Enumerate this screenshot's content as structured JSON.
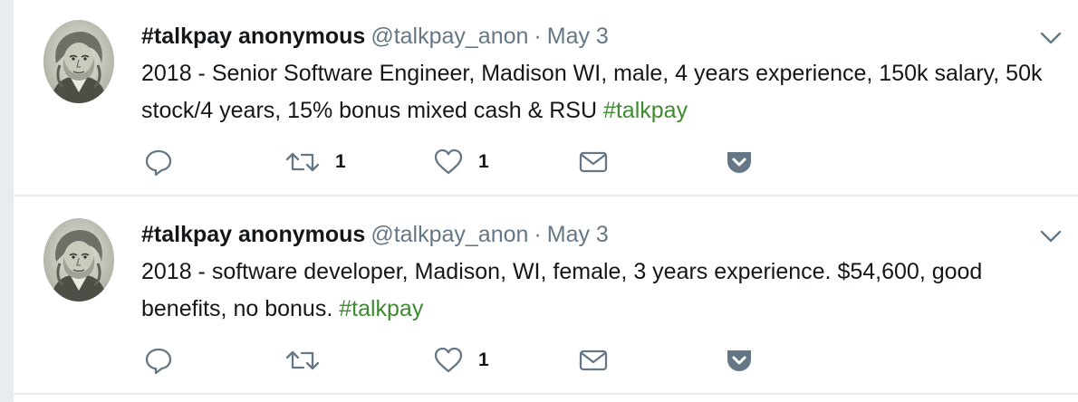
{
  "tweets": [
    {
      "name": "#talkpay anonymous",
      "handle": "@talkpay_anon",
      "separator": "·",
      "date": "May 3",
      "text_before": "2018 - Senior Software Engineer, Madison WI, male, 4 years experience, 150k salary, 50k stock/4 years, 15% bonus mixed cash & RSU ",
      "hashtag": "#talkpay",
      "text_after": "",
      "actions": {
        "reply_count": "",
        "retweet_count": "1",
        "like_count": "1"
      },
      "avatar_icon": "benjamin-franklin-portrait",
      "caret_icon": "chevron-down-icon"
    },
    {
      "name": "#talkpay anonymous",
      "handle": "@talkpay_anon",
      "separator": "·",
      "date": "May 3",
      "text_before": "2018 - software developer, Madison, WI, female, 3 years experience. $54,600, good benefits, no bonus. ",
      "hashtag": "#talkpay",
      "text_after": "",
      "actions": {
        "reply_count": "",
        "retweet_count": "",
        "like_count": "1"
      },
      "avatar_icon": "benjamin-franklin-portrait",
      "caret_icon": "chevron-down-icon"
    }
  ],
  "colors": {
    "name": "#14171a",
    "muted": "#657786",
    "hashtag": "#3d8b2f",
    "icon": "#657786",
    "pocket": "#657786",
    "divider": "#e6ecf0"
  }
}
